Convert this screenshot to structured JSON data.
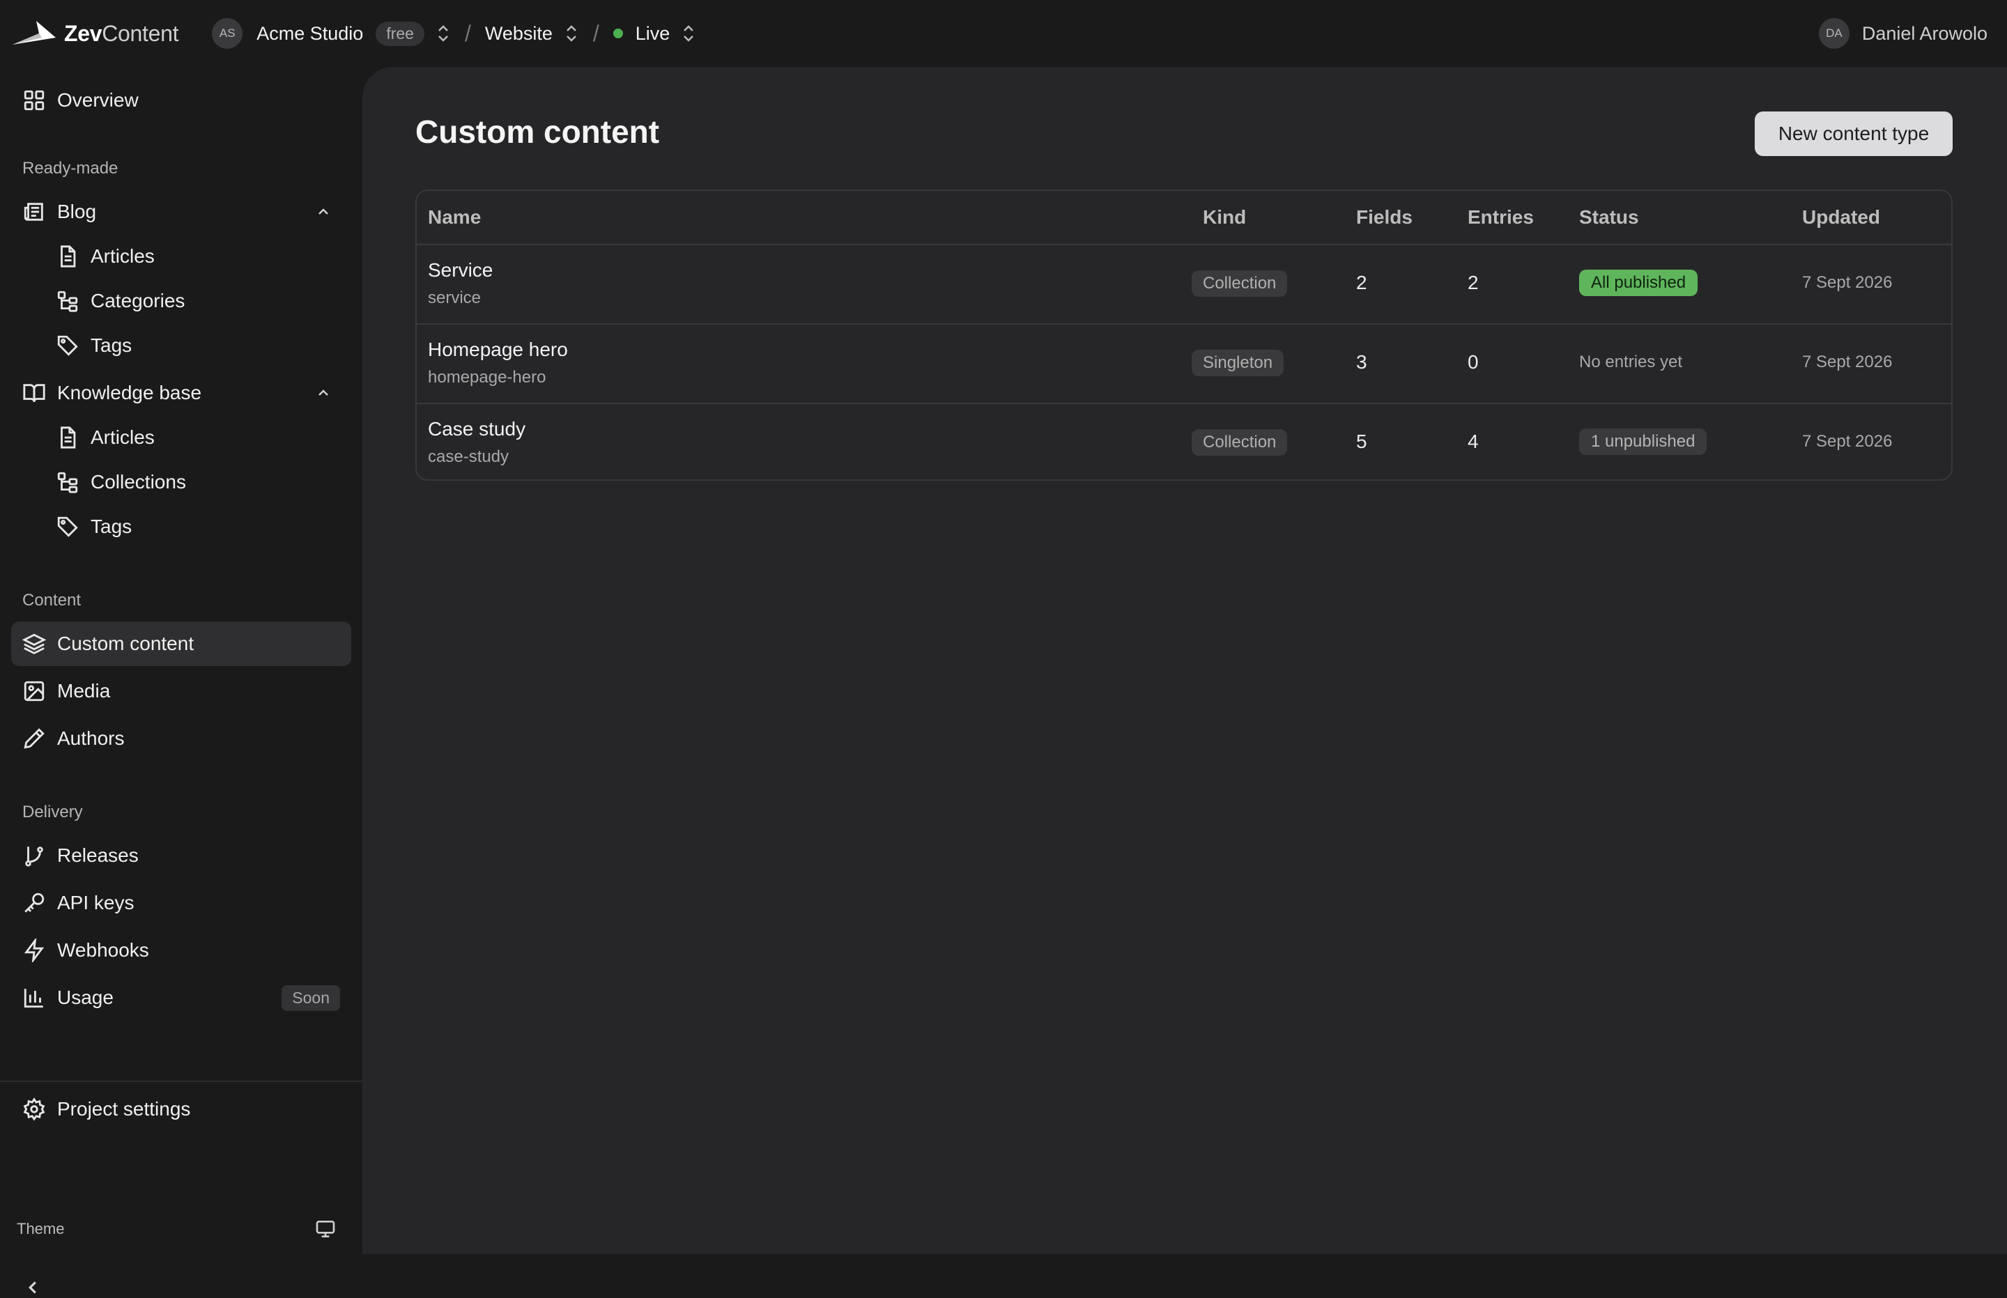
{
  "brand": {
    "name_bold": "Zev",
    "name_light": "Content"
  },
  "header": {
    "org_initials": "AS",
    "org_name": "Acme Studio",
    "plan": "free",
    "separator": "/",
    "project": "Website",
    "environment": "Live",
    "env_status_color": "#4caf50",
    "user_initials": "DA",
    "user_name": "Daniel Arowolo"
  },
  "sidebar": {
    "overview": "Overview",
    "sections": {
      "ready_made": "Ready-made",
      "content": "Content",
      "delivery": "Delivery"
    },
    "blog": {
      "label": "Blog",
      "articles": "Articles",
      "categories": "Categories",
      "tags": "Tags"
    },
    "knowledge_base": {
      "label": "Knowledge base",
      "articles": "Articles",
      "collections": "Collections",
      "tags": "Tags"
    },
    "custom_content": "Custom content",
    "media": "Media",
    "authors": "Authors",
    "releases": "Releases",
    "api_keys": "API keys",
    "webhooks": "Webhooks",
    "usage": "Usage",
    "usage_badge": "Soon",
    "project_settings": "Project settings",
    "theme_label": "Theme"
  },
  "main": {
    "title": "Custom content",
    "new_button": "New content type",
    "table": {
      "headers": {
        "name": "Name",
        "kind": "Kind",
        "fields": "Fields",
        "entries": "Entries",
        "status": "Status",
        "updated": "Updated"
      },
      "rows": [
        {
          "name": "Service",
          "slug": "service",
          "kind": "Collection",
          "fields": "2",
          "entries": "2",
          "status": "All published",
          "updated": "7 Sept 2026"
        },
        {
          "name": "Homepage hero",
          "slug": "homepage-hero",
          "kind": "Singleton",
          "fields": "3",
          "entries": "0",
          "status": "No entries yet",
          "updated": "7 Sept 2026"
        },
        {
          "name": "Case study",
          "slug": "case-study",
          "kind": "Collection",
          "fields": "5",
          "entries": "4",
          "status": "1 unpublished",
          "updated": "7 Sept 2026"
        }
      ]
    }
  }
}
